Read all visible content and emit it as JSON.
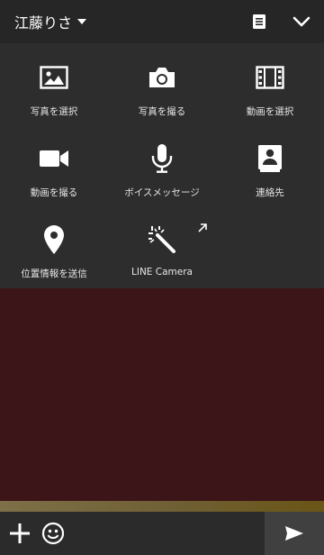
{
  "header": {
    "title": "江藤りさ",
    "icons": [
      "note-icon",
      "chevron-down-icon",
      "caret-down-icon"
    ]
  },
  "attachment_menu": {
    "items": [
      {
        "label": "写真を選択",
        "icon": "image-icon"
      },
      {
        "label": "写真を撮る",
        "icon": "camera-icon"
      },
      {
        "label": "動画を選択",
        "icon": "film-icon"
      },
      {
        "label": "動画を撮る",
        "icon": "video-camera-icon"
      },
      {
        "label": "ボイスメッセージ",
        "icon": "microphone-icon"
      },
      {
        "label": "連絡先",
        "icon": "contact-book-icon"
      },
      {
        "label": "位置情報を送信",
        "icon": "location-pin-icon"
      },
      {
        "label": "LINE Camera",
        "icon": "magic-wand-icon"
      }
    ]
  },
  "input_bar": {
    "icons": [
      "plus-icon",
      "emoji-icon",
      "send-icon"
    ]
  },
  "colors": {
    "header_bg": "#262626",
    "panel_bg": "#2d2d2d",
    "chat_bg": "#3c1518",
    "input_bar_bg": "#2b2b2b",
    "send_bg": "#404040"
  }
}
